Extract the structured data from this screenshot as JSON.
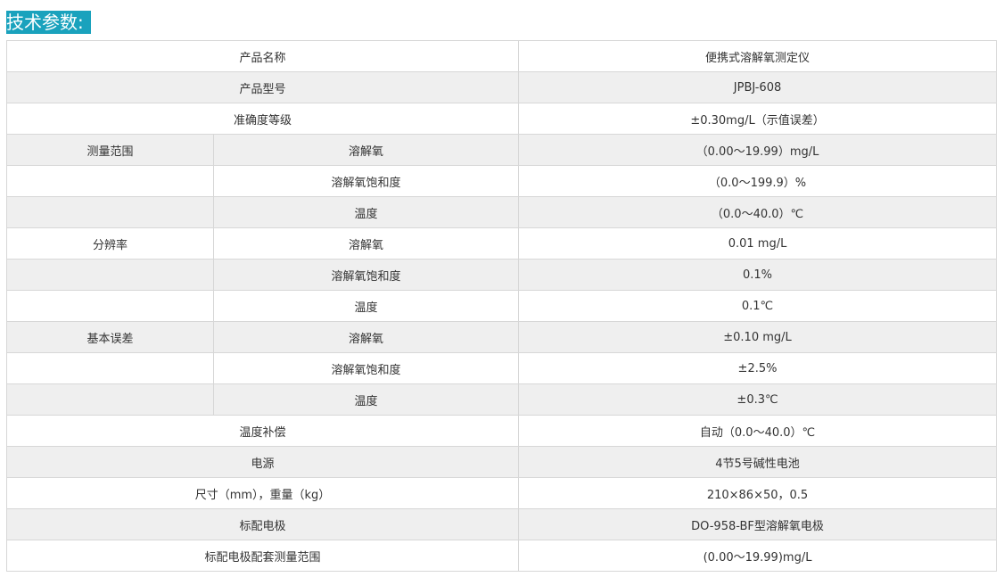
{
  "heading": "技术参数:",
  "rows": [
    {
      "label": "产品名称",
      "value": "便携式溶解氧测定仪"
    },
    {
      "label": "产品型号",
      "value": "JPBJ-608"
    },
    {
      "label": "准确度等级",
      "value": "±0.30mg/L（示值误差）"
    },
    {
      "group": "测量范围",
      "sub": "溶解氧",
      "value": "（0.00～19.99）mg/L"
    },
    {
      "group": "",
      "sub": "溶解氧饱和度",
      "value": "（0.0～199.9）%"
    },
    {
      "group": "",
      "sub": "温度",
      "value": "（0.0～40.0）℃"
    },
    {
      "group": "分辨率",
      "sub": "溶解氧",
      "value": "0.01 mg/L"
    },
    {
      "group": "",
      "sub": "溶解氧饱和度",
      "value": "0.1%"
    },
    {
      "group": "",
      "sub": "温度",
      "value": "0.1℃"
    },
    {
      "group": "基本误差",
      "sub": "溶解氧",
      "value": "±0.10 mg/L"
    },
    {
      "group": "",
      "sub": "溶解氧饱和度",
      "value": "±2.5%"
    },
    {
      "group": "",
      "sub": "温度",
      "value": "±0.3℃"
    },
    {
      "label": "温度补偿",
      "value": "自动（0.0～40.0）℃"
    },
    {
      "label": "电源",
      "value": "4节5号碱性电池"
    },
    {
      "label": "尺寸（mm），重量（kg）",
      "value": "210×86×50，0.5"
    },
    {
      "label": "标配电极",
      "value": "DO-958-BF型溶解氧电极"
    },
    {
      "label": "标配电极配套测量范围",
      "value": "(0.00～19.99)mg/L"
    }
  ]
}
